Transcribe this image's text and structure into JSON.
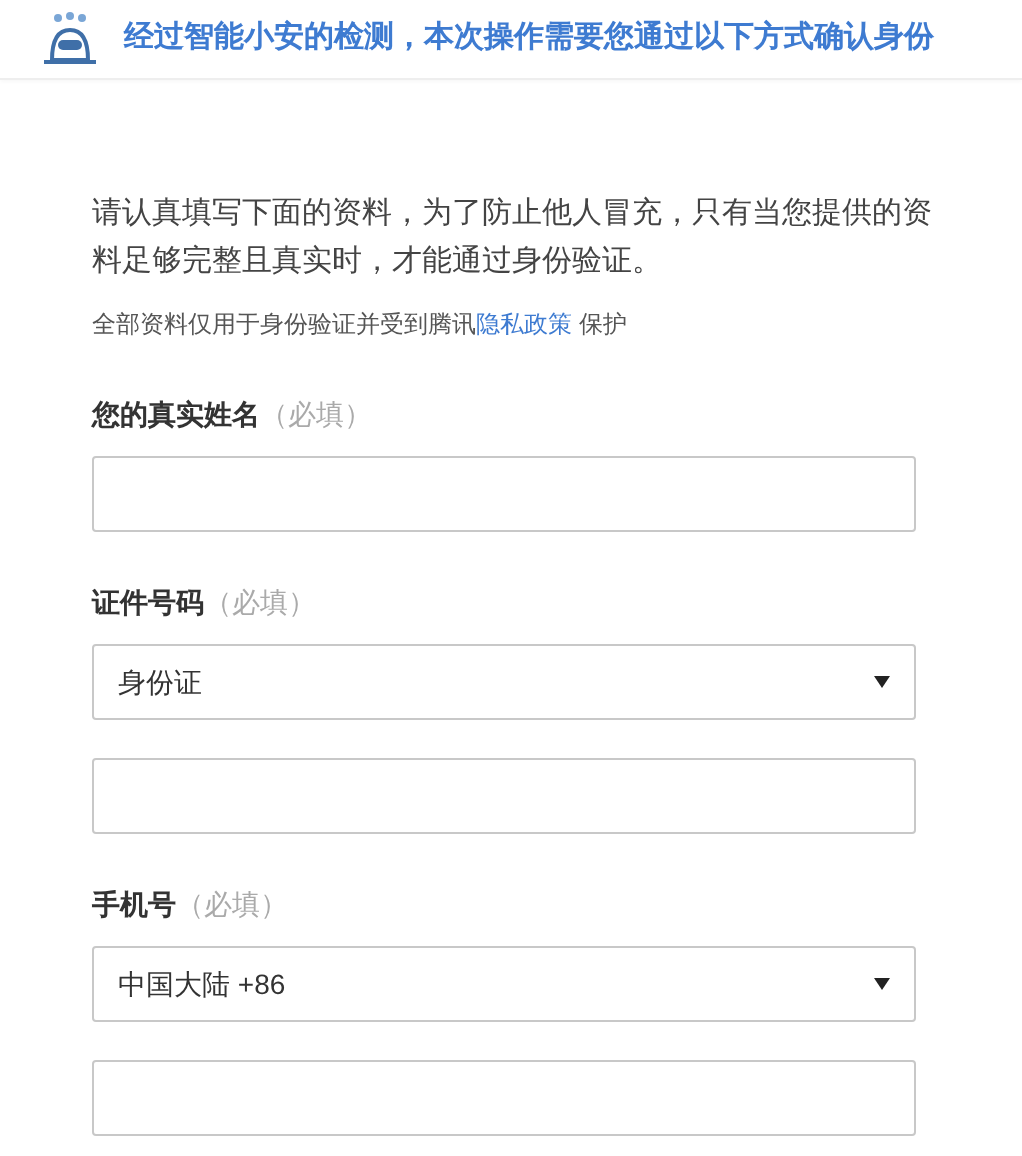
{
  "header": {
    "title": "经过智能小安的检测，本次操作需要您通过以下方式确认身份"
  },
  "intro": "请认真填写下面的资料，为了防止他人冒充，只有当您提供的资料足够完整且真实时，才能通过身份验证。",
  "note": {
    "before": "全部资料仅用于身份验证并受到腾讯",
    "link": "隐私政策",
    "after": "保护"
  },
  "sections": [
    {
      "label": "您的真实姓名",
      "hint": "（必填）",
      "controls": [
        {
          "kind": "input"
        }
      ]
    },
    {
      "label": "证件号码",
      "hint": "（必填）",
      "controls": [
        {
          "kind": "select",
          "value": "身份证"
        },
        {
          "kind": "input"
        }
      ]
    },
    {
      "label": "手机号",
      "hint": "（必填）",
      "controls": [
        {
          "kind": "select",
          "value": "中国大陆 +86"
        },
        {
          "kind": "input"
        }
      ]
    }
  ]
}
